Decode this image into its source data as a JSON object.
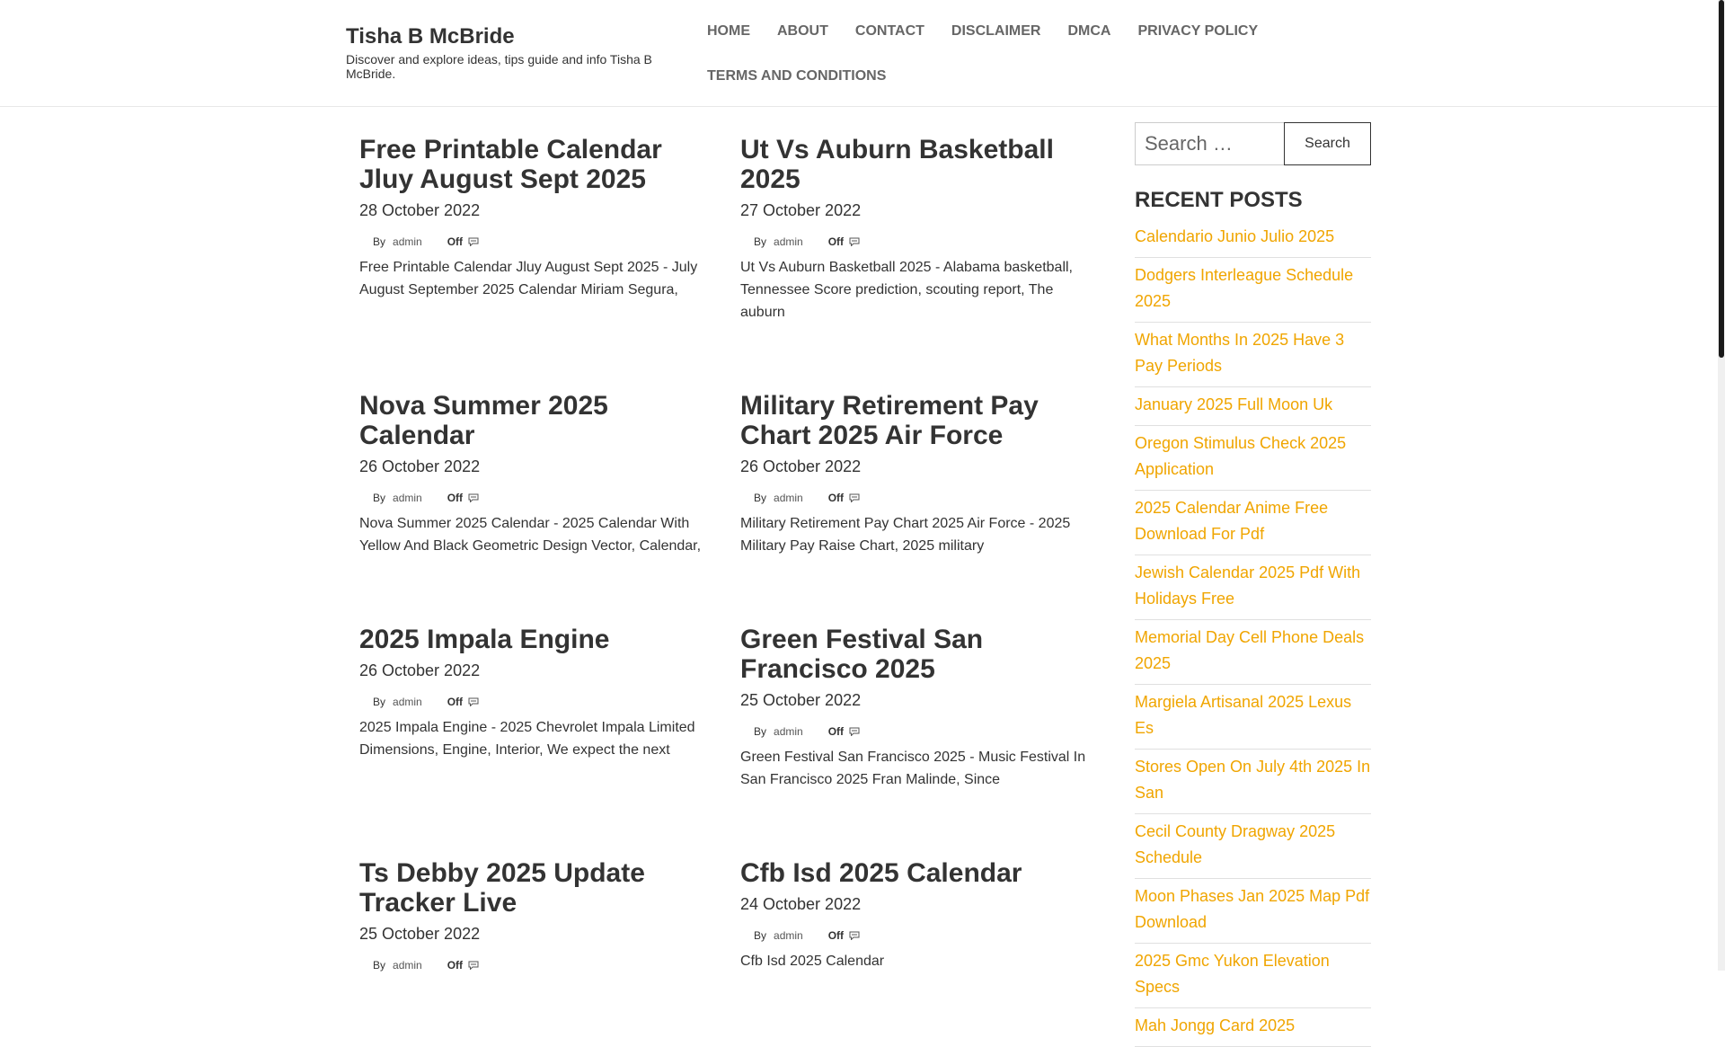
{
  "site": {
    "title": "Tisha B McBride",
    "description": "Discover and explore ideas, tips guide and info Tisha B McBride."
  },
  "nav": {
    "items": [
      "HOME",
      "ABOUT",
      "CONTACT",
      "DISCLAIMER",
      "DMCA",
      "PRIVACY POLICY",
      "TERMS AND CONDITIONS"
    ]
  },
  "meta_labels": {
    "by": "By",
    "comments": "Off"
  },
  "icons": {
    "author": "user-icon",
    "comments": "comment-bubble-icon"
  },
  "posts": [
    {
      "title": "Free Printable Calendar Jluy August Sept 2025",
      "date": "28 October 2022",
      "author": "admin",
      "excerpt": "Free Printable Calendar Jluy August Sept 2025 - July August September 2025 Calendar Miriam Segura,"
    },
    {
      "title": "Ut Vs Auburn Basketball 2025",
      "date": "27 October 2022",
      "author": "admin",
      "excerpt": "Ut Vs Auburn Basketball 2025 - Alabama basketball, Tennessee Score prediction, scouting report, The auburn"
    },
    {
      "title": "Nova Summer 2025 Calendar",
      "date": "26 October 2022",
      "author": "admin",
      "excerpt": "Nova Summer 2025 Calendar - 2025 Calendar With Yellow And Black Geometric Design Vector, Calendar,"
    },
    {
      "title": "Military Retirement Pay Chart 2025 Air Force",
      "date": "26 October 2022",
      "author": "admin",
      "excerpt": "Military Retirement Pay Chart 2025 Air Force - 2025 Military Pay Raise Chart, 2025 military"
    },
    {
      "title": "2025 Impala Engine",
      "date": "26 October 2022",
      "author": "admin",
      "excerpt": "2025 Impala Engine - 2025 Chevrolet Impala Limited Dimensions, Engine, Interior, We expect the next"
    },
    {
      "title": "Green Festival San Francisco 2025",
      "date": "25 October 2022",
      "author": "admin",
      "excerpt": "Green Festival San Francisco 2025 - Music Festival In San Francisco 2025 Fran Malinde, Since"
    },
    {
      "title": "Ts Debby 2025 Update Tracker Live",
      "date": "25 October 2022",
      "author": "admin",
      "excerpt": ""
    },
    {
      "title": "Cfb Isd 2025 Calendar",
      "date": "24 October 2022",
      "author": "admin",
      "excerpt": "Cfb Isd 2025 Calendar"
    }
  ],
  "sidebar": {
    "search_placeholder": "Search …",
    "search_button": "Search",
    "recent_title": "RECENT POSTS",
    "recent_posts": [
      "Calendario Junio Julio 2025",
      "Dodgers Interleague Schedule 2025",
      "What Months In 2025 Have 3 Pay Periods",
      "January 2025 Full Moon Uk",
      "Oregon Stimulus Check 2025 Application",
      "2025 Calendar Anime Free Download For Pdf",
      "Jewish Calendar 2025 Pdf With Holidays Free",
      "Memorial Day Cell Phone Deals 2025",
      "Margiela Artisanal 2025 Lexus Es",
      "Stores Open On July 4th 2025 In San",
      "Cecil County Dragway 2025 Schedule",
      "Moon Phases Jan 2025 Map Pdf Download",
      "2025 Gmc Yukon Elevation Specs",
      "Mah Jongg Card 2025"
    ]
  },
  "colors": {
    "link_accent": "#f0a500",
    "text": "#333333",
    "nav_text": "#666666"
  }
}
